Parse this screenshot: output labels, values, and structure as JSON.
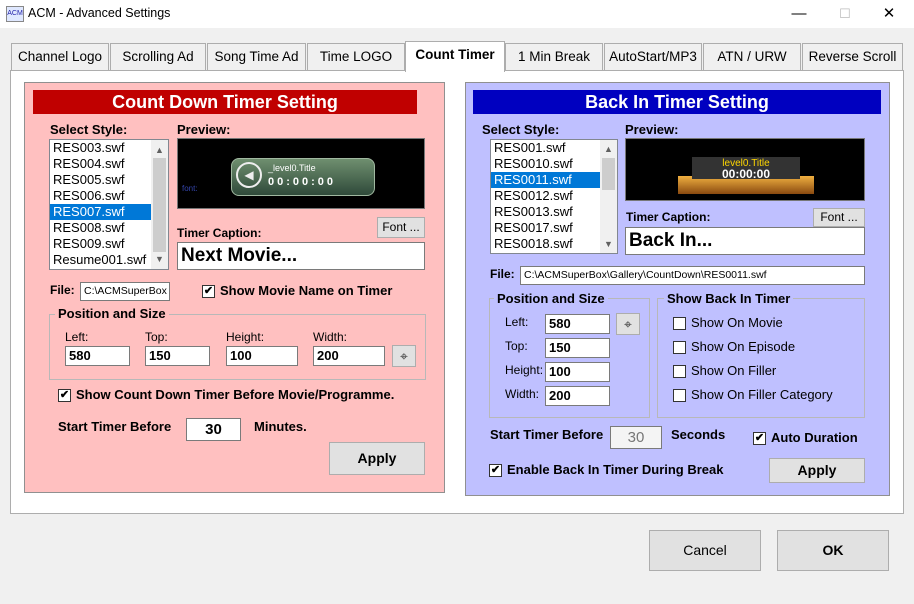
{
  "window": {
    "title": "ACM - Advanced Settings",
    "minimize": "—",
    "maximize": "☐",
    "close": "✕"
  },
  "tabs": [
    "Channel Logo",
    "Scrolling Ad",
    "Song Time Ad",
    "Time LOGO",
    "Count Timer",
    "1 Min Break",
    "AutoStart/MP3",
    "ATN / URW",
    "Reverse Scroll"
  ],
  "active_tab": "Count Timer",
  "countdown": {
    "header": "Count Down Timer Setting",
    "select_style_label": "Select Style:",
    "styles": [
      "RES003.swf",
      "RES004.swf",
      "RES005.swf",
      "RES006.swf",
      "RES007.swf",
      "RES008.swf",
      "RES009.swf",
      "Resume001.swf"
    ],
    "selected_style": "RES007.swf",
    "preview_label": "Preview:",
    "preview_caption": "_level0.Title",
    "preview_time": "00:00:00",
    "preview_font_text": "font:",
    "font_button": "Font ...",
    "timer_caption_label": "Timer Caption:",
    "timer_caption": "Next Movie...",
    "file_label": "File:",
    "file_value": "C:\\ACMSuperBox",
    "show_movie_name": "Show Movie Name on Timer",
    "position_group": "Position and Size",
    "left_label": "Left:",
    "left": "580",
    "top_label": "Top:",
    "top": "150",
    "height_label": "Height:",
    "height": "100",
    "width_label": "Width:",
    "width": "200",
    "show_before": "Show Count Down Timer Before Movie/Programme.",
    "start_before_label": "Start Timer Before",
    "start_before_value": "30",
    "minutes_label": "Minutes.",
    "apply": "Apply"
  },
  "backin": {
    "header": "Back In Timer Setting",
    "select_style_label": "Select Style:",
    "styles": [
      "RES001.swf",
      "RES0010.swf",
      "RES0011.swf",
      "RES0012.swf",
      "RES0013.swf",
      "RES0017.swf",
      "RES0018.swf"
    ],
    "selected_style": "RES0011.swf",
    "preview_label": "Preview:",
    "preview_caption": "level0.Title",
    "preview_time": "00:00:00",
    "font_button": "Font ...",
    "timer_caption_label": "Timer Caption:",
    "timer_caption": "Back In...",
    "file_label": "File:",
    "file_value": "C:\\ACMSuperBox\\Gallery\\CountDown\\RES0011.swf",
    "position_group": "Position and Size",
    "left_label": "Left:",
    "left": "580",
    "top_label": "Top:",
    "top": "150",
    "height_label": "Height:",
    "height": "100",
    "width_label": "Width:",
    "width": "200",
    "show_group": "Show Back In Timer",
    "show_on_movie": "Show On Movie",
    "show_on_episode": "Show On Episode",
    "show_on_filler": "Show On Filler",
    "show_on_filler_category": "Show On Filler Category",
    "start_before_label": "Start Timer Before",
    "start_before_value": "30",
    "seconds_label": "Seconds",
    "auto_duration": "Auto Duration",
    "enable_during_break": "Enable Back In Timer During Break",
    "apply": "Apply"
  },
  "footer": {
    "cancel": "Cancel",
    "ok": "OK"
  },
  "checkmark": "✔",
  "icons": {
    "app": "acm-icon",
    "position": "crosshair-icon"
  },
  "colors": {
    "countdown_header": "#c00000",
    "backin_header": "#0000c0",
    "countdown_bg": "#ffc0c0",
    "backin_bg": "#bfc0ff",
    "selection": "#0078d7"
  }
}
